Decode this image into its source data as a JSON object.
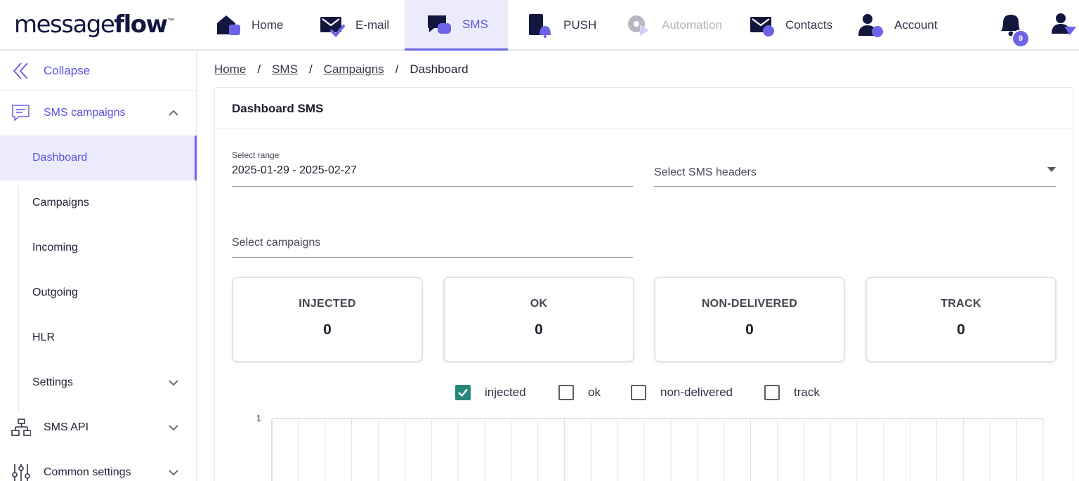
{
  "header": {
    "logo_light": "message",
    "logo_bold": "flow",
    "logo_tm": "™",
    "nav": [
      {
        "label": "Home",
        "icon": "home-icon",
        "active": false,
        "disabled": false
      },
      {
        "label": "E-mail",
        "icon": "email-icon",
        "active": false,
        "disabled": false
      },
      {
        "label": "SMS",
        "icon": "sms-icon",
        "active": true,
        "disabled": false
      },
      {
        "label": "PUSH",
        "icon": "push-icon",
        "active": false,
        "disabled": false
      },
      {
        "label": "Automation",
        "icon": "automation-icon",
        "active": false,
        "disabled": true
      },
      {
        "label": "Contacts",
        "icon": "contacts-icon",
        "active": false,
        "disabled": false
      },
      {
        "label": "Account",
        "icon": "account-icon",
        "active": false,
        "disabled": false
      }
    ],
    "notifications_count": "9",
    "colors": {
      "accent": "#6d63e8",
      "navy": "#13163d",
      "active_bg": "#ecebfb",
      "checkbox_on": "#24867a"
    }
  },
  "sidebar": {
    "collapse_label": "Collapse",
    "section_sms": "SMS campaigns",
    "items": [
      "Dashboard",
      "Campaigns",
      "Incoming",
      "Outgoing",
      "HLR",
      "Settings"
    ],
    "section_api": "SMS API",
    "section_common": "Common settings"
  },
  "breadcrumb": {
    "items": [
      "Home",
      "SMS",
      "Campaigns"
    ],
    "separator": "/",
    "current": "Dashboard"
  },
  "main": {
    "title": "Dashboard SMS",
    "range_label": "Select range",
    "range_value": "2025-01-29 - 2025-02-27",
    "headers_placeholder": "Select SMS headers",
    "campaigns_placeholder": "Select campaigns",
    "stats": [
      {
        "title": "INJECTED",
        "value": "0"
      },
      {
        "title": "OK",
        "value": "0"
      },
      {
        "title": "NON-DELIVERED",
        "value": "0"
      },
      {
        "title": "TRACK",
        "value": "0"
      }
    ],
    "legend": [
      {
        "label": "injected",
        "checked": true
      },
      {
        "label": "ok",
        "checked": false
      },
      {
        "label": "non-delivered",
        "checked": false
      },
      {
        "label": "track",
        "checked": false
      }
    ]
  },
  "chart_data": {
    "type": "bar",
    "series": [
      {
        "name": "injected",
        "values": []
      }
    ],
    "y_ticks": [
      "1"
    ],
    "ylim": [
      0,
      1
    ],
    "grid": true
  }
}
